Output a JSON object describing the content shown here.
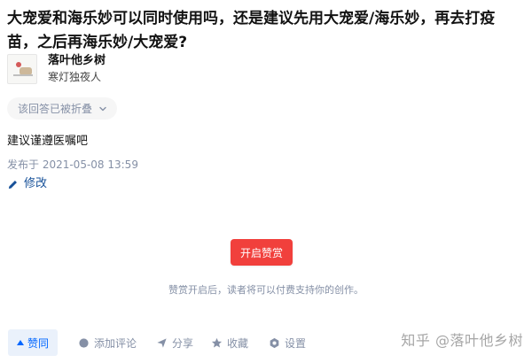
{
  "question": {
    "title": "大宠爱和海乐妙可以同时使用吗，还是建议先用大宠爱/海乐妙，再去打疫苗，之后再海乐妙/大宠爱?"
  },
  "author": {
    "name": "落叶他乡树",
    "headline": "寒灯独夜人"
  },
  "answer": {
    "folded_label": "该回答已被折叠",
    "content": "建议谨遵医嘱吧",
    "publish_time": "发布于 2021-05-08 13:59",
    "edit_label": "修改"
  },
  "reward": {
    "button_label": "开启赞赏",
    "description": "赞赏开启后，读者将可以付费支持你的创作。"
  },
  "actions": {
    "vote_label": "赞同",
    "comment_label": "添加评论",
    "share_label": "分享",
    "favorite_label": "收藏",
    "settings_label": "设置"
  },
  "watermark": {
    "text": "知乎 @落叶他乡树"
  },
  "colors": {
    "accent": "#0066ff",
    "reward": "#f1403c",
    "muted": "#8590a6",
    "link": "#175199"
  }
}
